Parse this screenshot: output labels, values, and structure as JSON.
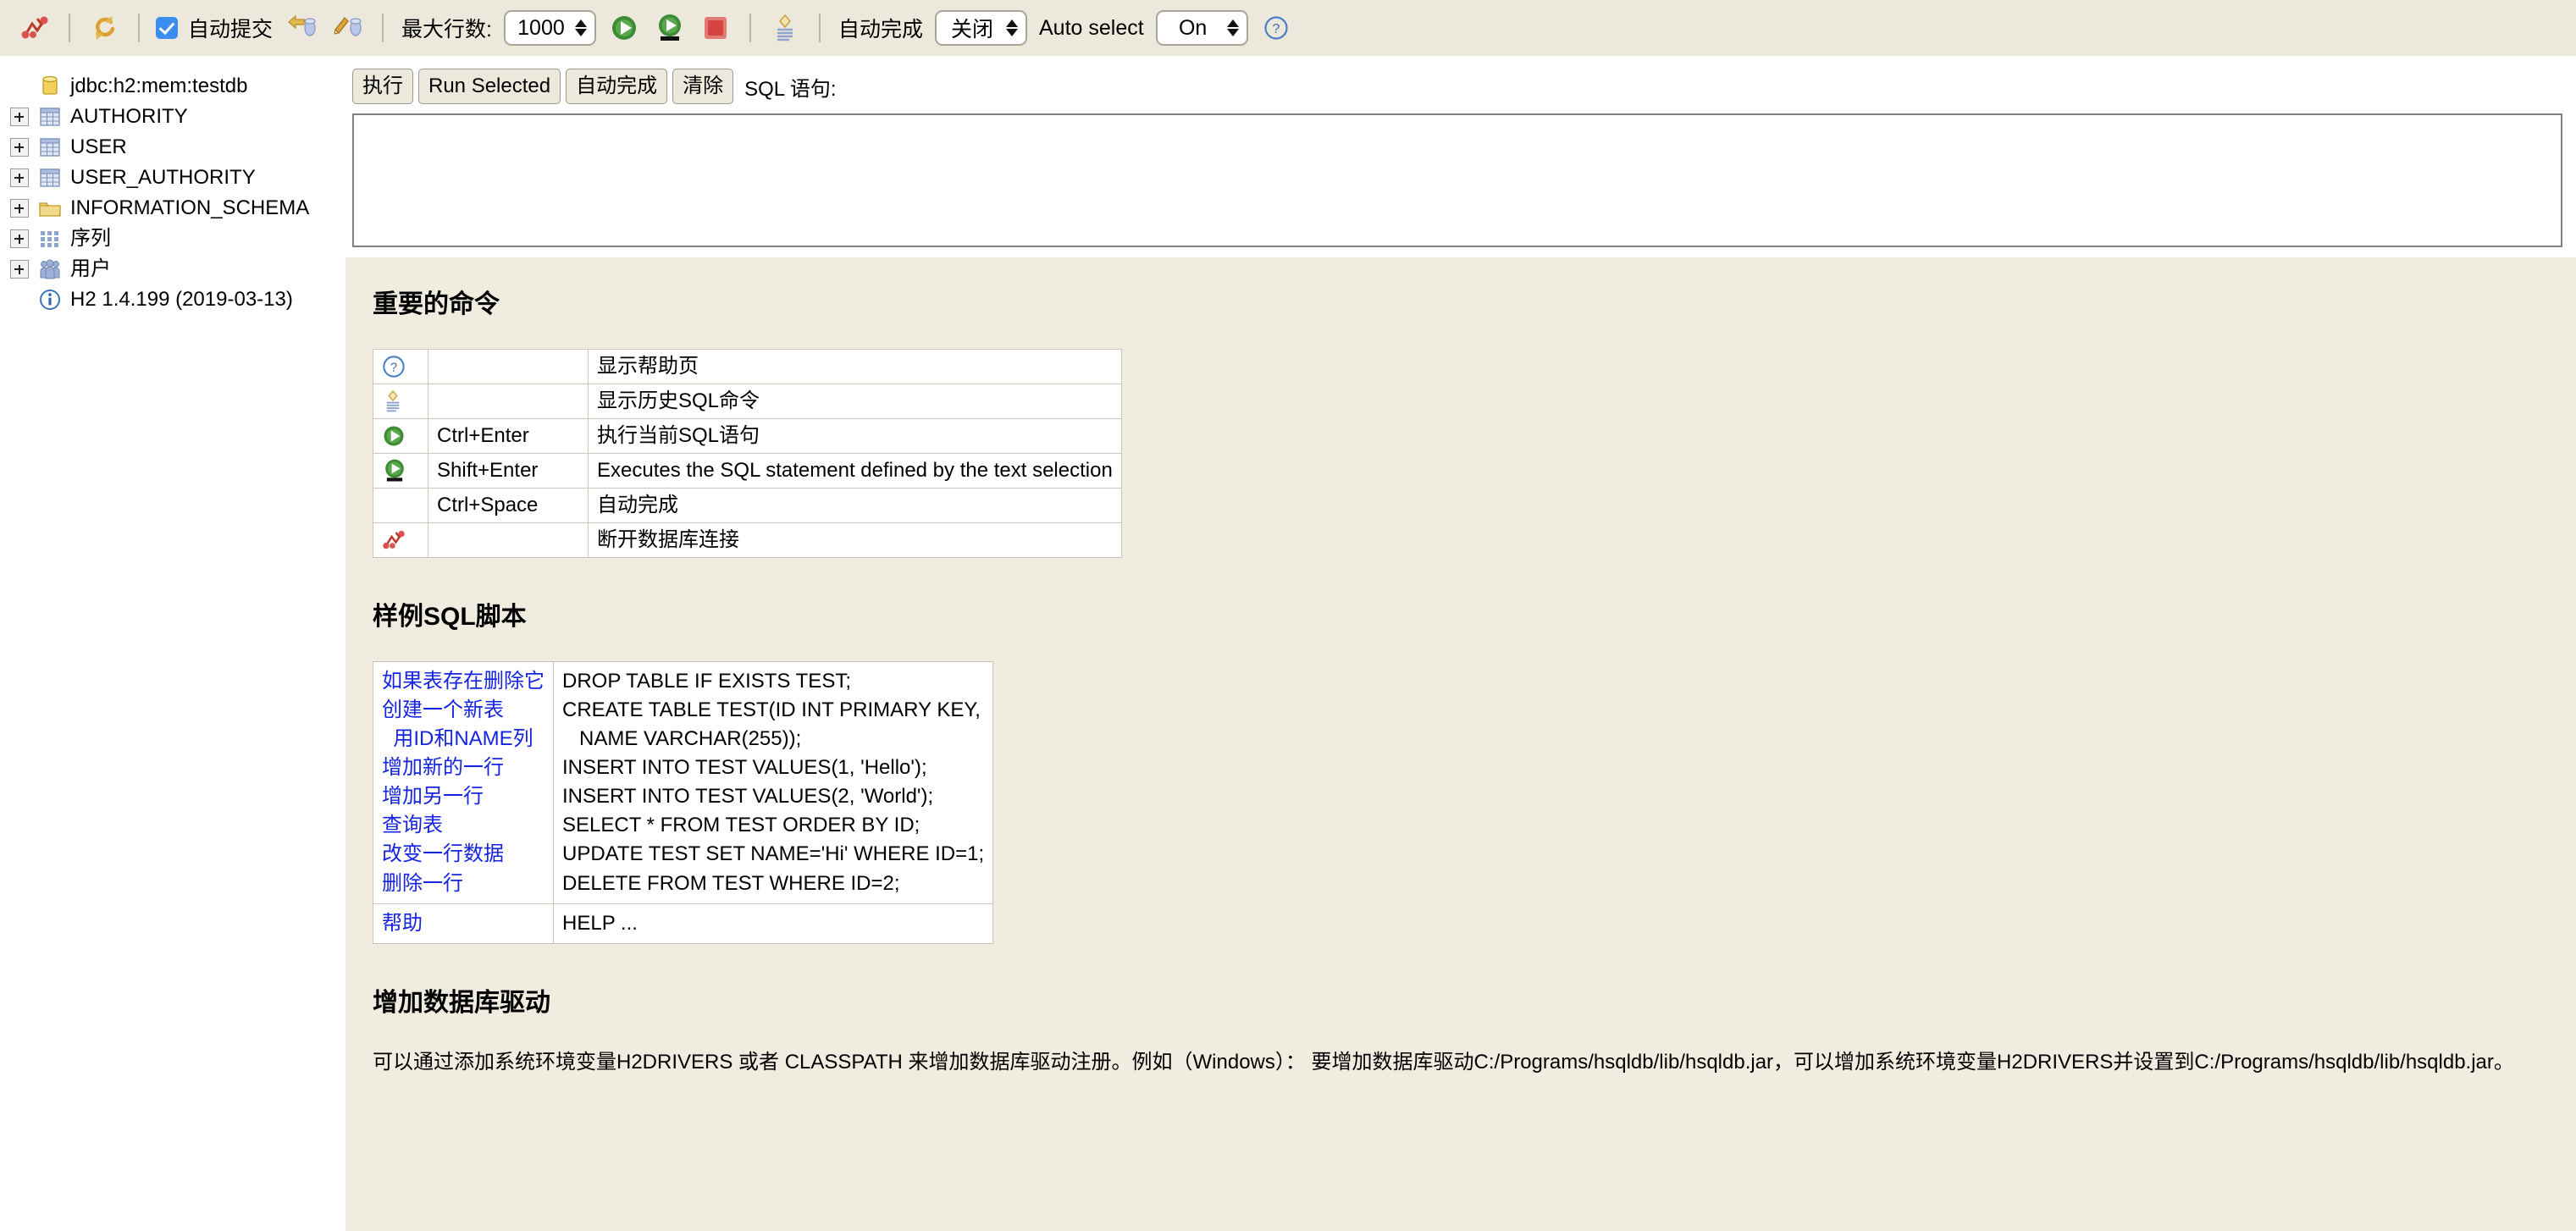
{
  "toolbar": {
    "disconnect_icon": "disconnect-icon",
    "refresh_icon": "refresh-icon",
    "autocommit_label": "自动提交",
    "rollback_icon": "rollback-icon",
    "commit_icon": "commit-icon",
    "maxrows_label": "最大行数:",
    "maxrows_value": "1000",
    "run_icon": "run-icon",
    "run_selected_icon": "run-selected-icon",
    "stop_icon": "stop-icon",
    "history_icon": "history-icon",
    "autocomplete_label": "自动完成",
    "autocomplete_value": "关闭",
    "autoselect_label": "Auto select",
    "autoselect_value": "On",
    "help_icon": "help-icon"
  },
  "sidebar": {
    "items": [
      {
        "label": "jdbc:h2:mem:testdb",
        "icon": "database-icon",
        "expandable": false
      },
      {
        "label": "AUTHORITY",
        "icon": "table-icon",
        "expandable": true
      },
      {
        "label": "USER",
        "icon": "table-icon",
        "expandable": true
      },
      {
        "label": "USER_AUTHORITY",
        "icon": "table-icon",
        "expandable": true
      },
      {
        "label": "INFORMATION_SCHEMA",
        "icon": "folder-icon",
        "expandable": true
      },
      {
        "label": "序列",
        "icon": "sequence-icon",
        "expandable": true
      },
      {
        "label": "用户",
        "icon": "users-icon",
        "expandable": true
      },
      {
        "label": "H2 1.4.199 (2019-03-13)",
        "icon": "info-icon",
        "expandable": false
      }
    ]
  },
  "sqlbar": {
    "run_label": "执行",
    "run_selected_label": "Run Selected",
    "autocomplete_label": "自动完成",
    "clear_label": "清除",
    "sql_label": "SQL 语句:",
    "editor_value": "",
    "editor_placeholder": ""
  },
  "content": {
    "commands_heading": "重要的命令",
    "commands": [
      {
        "icon": "help-icon",
        "key": "",
        "desc": "显示帮助页"
      },
      {
        "icon": "history-icon",
        "key": "",
        "desc": "显示历史SQL命令"
      },
      {
        "icon": "run-icon",
        "key": "Ctrl+Enter",
        "desc": "执行当前SQL语句"
      },
      {
        "icon": "run-selected-icon",
        "key": "Shift+Enter",
        "desc": "Executes the SQL statement defined by the text selection"
      },
      {
        "icon": "",
        "key": "Ctrl+Space",
        "desc": "自动完成"
      },
      {
        "icon": "disconnect-icon",
        "key": "",
        "desc": "断开数据库连接"
      }
    ],
    "sample_heading": "样例SQL脚本",
    "sample_rows": [
      {
        "note": "如果表存在删除它\n创建一个新表\n  用ID和NAME列\n增加新的一行\n增加另一行\n查询表\n改变一行数据\n删除一行",
        "sql": "DROP TABLE IF EXISTS TEST;\nCREATE TABLE TEST(ID INT PRIMARY KEY,\n   NAME VARCHAR(255));\nINSERT INTO TEST VALUES(1, 'Hello');\nINSERT INTO TEST VALUES(2, 'World');\nSELECT * FROM TEST ORDER BY ID;\nUPDATE TEST SET NAME='Hi' WHERE ID=1;\nDELETE FROM TEST WHERE ID=2;"
      },
      {
        "note": "帮助",
        "sql": "HELP ..."
      }
    ],
    "drivers_heading": "增加数据库驱动",
    "drivers_text": "可以通过添加系统环境变量H2DRIVERS 或者 CLASSPATH 来增加数据库驱动注册。例如（Windows）： 要增加数据库驱动C:/Programs/hsqldb/lib/hsqldb.jar，可以增加系统环境变量H2DRIVERS并设置到C:/Programs/hsqldb/lib/hsqldb.jar。"
  },
  "colors": {
    "toolbar_bg": "#ece9dc",
    "content_bg": "#f0ece0",
    "pane_bg": "#ffffff",
    "note_blue": "#1524e0",
    "accent_blue": "#3b8ef0",
    "green": "#3e8b35",
    "red": "#d94a4a",
    "gold": "#e3b24a"
  }
}
